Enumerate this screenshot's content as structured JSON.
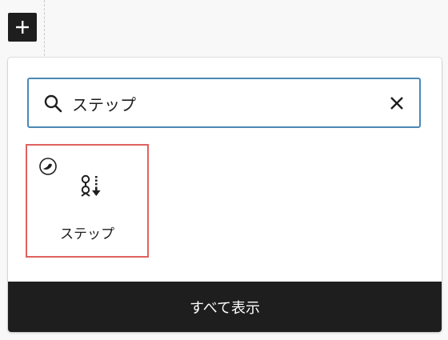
{
  "toolbar": {
    "add_block_icon": "plus-icon"
  },
  "inserter": {
    "search": {
      "value": "ステップ",
      "icons": {
        "search": "search-icon",
        "clear": "close-icon"
      }
    },
    "results": [
      {
        "label": "ステップ",
        "icon": "step-list-icon",
        "badge_icon": "plugin-badge-icon"
      }
    ],
    "footer_label": "すべて表示"
  },
  "colors": {
    "focus_border": "#4a88b8",
    "highlight_border": "#e06160",
    "footer_bg": "#1e1e1e",
    "toggle_bg": "#1e1e1e"
  }
}
